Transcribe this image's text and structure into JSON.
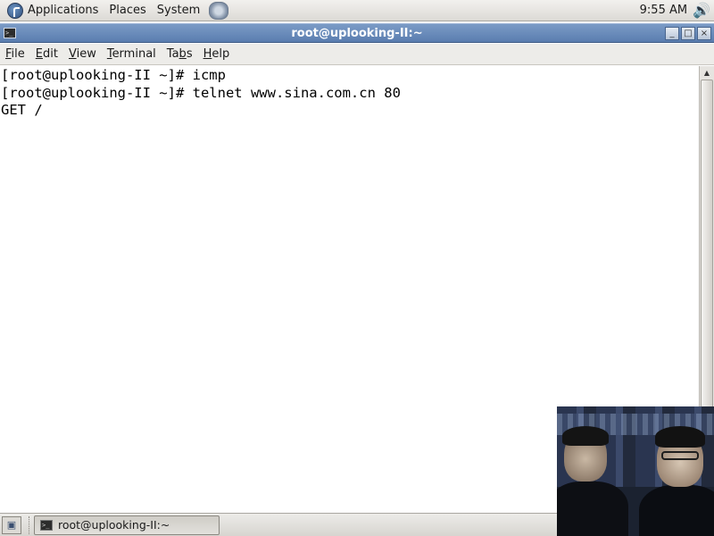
{
  "top_panel": {
    "menus": [
      "Applications",
      "Places",
      "System"
    ],
    "clock": "9:55 AM",
    "icons": {
      "applications": "fedora-logo-icon",
      "launcher": "web-browser-icon",
      "volume": "volume-icon"
    }
  },
  "window": {
    "title": "root@uplooking-II:~",
    "buttons": {
      "minimize": "_",
      "maximize": "□",
      "close": "×"
    }
  },
  "menubar": {
    "items": [
      {
        "label": "File",
        "accel": "F",
        "rest": "ile"
      },
      {
        "label": "Edit",
        "accel": "E",
        "rest": "dit"
      },
      {
        "label": "View",
        "accel": "V",
        "rest": "iew"
      },
      {
        "label": "Terminal",
        "accel": "T",
        "rest": "erminal"
      },
      {
        "label": "Tabs",
        "pre": "Ta",
        "accel": "b",
        "rest": "s"
      },
      {
        "label": "Help",
        "accel": "H",
        "rest": "elp"
      }
    ]
  },
  "terminal": {
    "lines": [
      "[root@uplooking-II ~]# icmp",
      "[root@uplooking-II ~]# telnet www.sina.com.cn 80",
      "GET /"
    ]
  },
  "taskbar": {
    "items": [
      {
        "label": "root@uplooking-II:~",
        "icon": "terminal-icon"
      }
    ]
  }
}
